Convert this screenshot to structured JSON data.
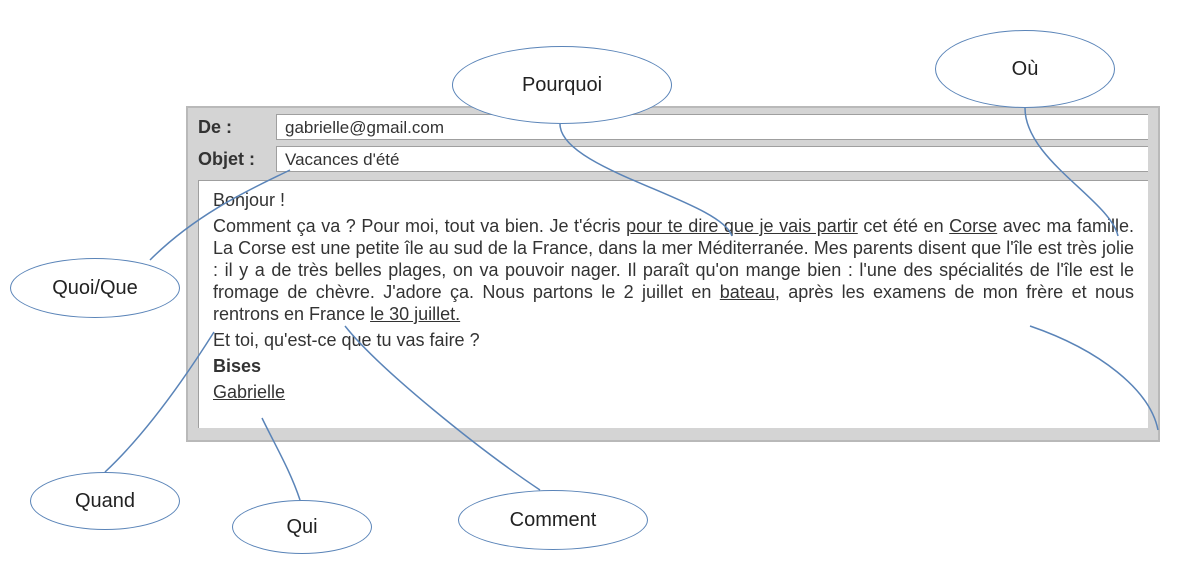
{
  "email": {
    "from_label": "De :",
    "from_value": "gabrielle@gmail.com",
    "subject_label": "Objet :",
    "subject_value": "Vacances d'été",
    "body": {
      "greeting": "Bonjour !",
      "p1_a": "Comment ça va ? Pour moi, tout va bien. Je t'écris ",
      "p1_pourquoi": "pour te dire que je vais partir",
      "p1_b": " cet été en ",
      "p1_ou": "Corse",
      "p1_c": " avec ma famille. La Corse est une petite île au sud de la France, dans la mer Méditerranée. Mes parents disent que l'île est très jolie : il y a de très belles plages, on va pouvoir nager. Il paraît qu'on mange bien : l'une des spécialités de l'île est le fromage de chèvre. J'adore ça. Nous partons le 2 juillet en ",
      "p1_comment": "bateau",
      "p1_d": ", après les examens de mon frère et nous rentrons en France ",
      "p1_quand": "le 30 juillet.",
      "p2": "Et toi, qu'est-ce que tu vas faire ?",
      "closing": "Bises",
      "signature": "Gabrielle"
    }
  },
  "callouts": {
    "pourquoi": "Pourquoi",
    "ou": "Où",
    "quoi": "Quoi/Que",
    "quand": "Quand",
    "qui": "Qui",
    "comment": "Comment"
  }
}
